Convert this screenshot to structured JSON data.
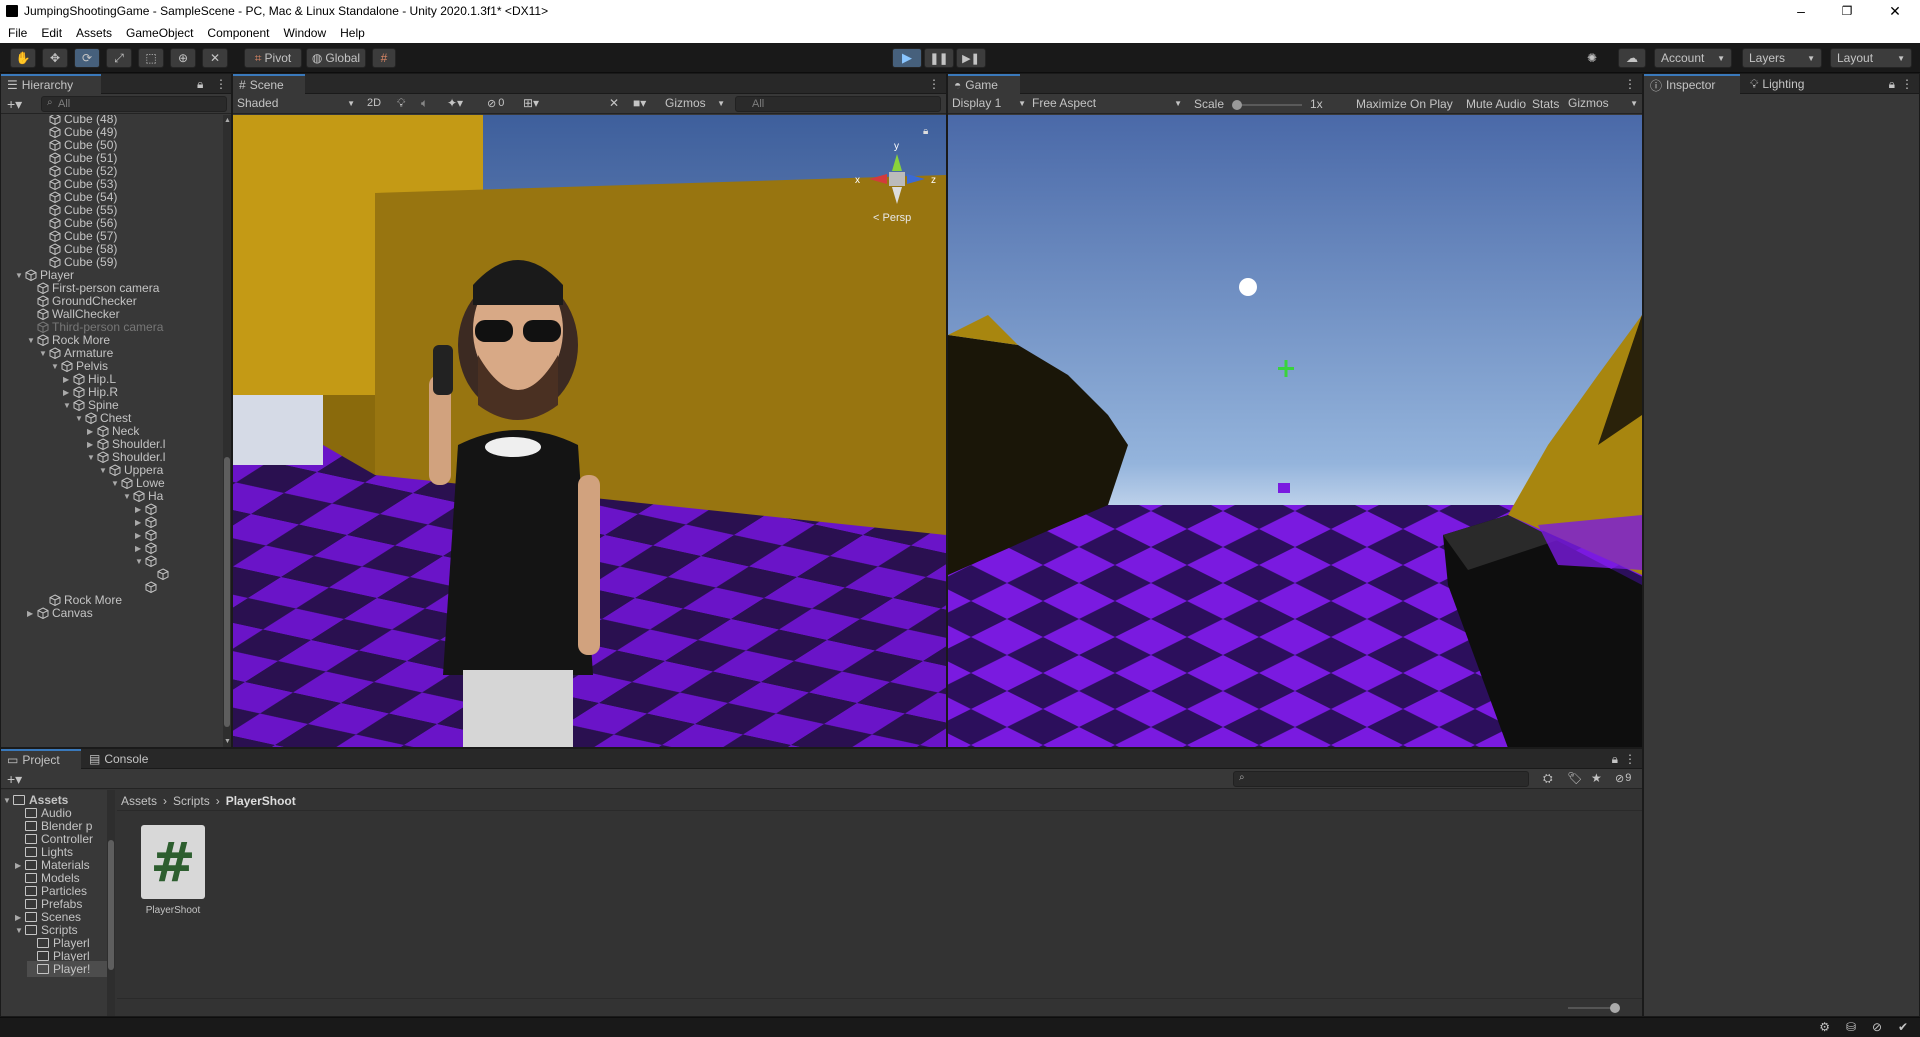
{
  "window": {
    "title": "JumpingShootingGame - SampleScene - PC, Mac & Linux Standalone - Unity 2020.1.3f1* <DX11>",
    "controls": [
      "–",
      "❐",
      "✕"
    ]
  },
  "menu": [
    "File",
    "Edit",
    "Assets",
    "GameObject",
    "Component",
    "Window",
    "Help"
  ],
  "toolbar": {
    "pivot_label": "Pivot",
    "global_label": "Global",
    "account_label": "Account",
    "layers_label": "Layers",
    "layout_label": "Layout",
    "play_active": true
  },
  "hierarchy": {
    "tab_label": "Hierarchy",
    "search_placeholder": "All",
    "items": [
      {
        "label": "Cube (48)",
        "depth": 3,
        "arrow": ""
      },
      {
        "label": "Cube (49)",
        "depth": 3,
        "arrow": ""
      },
      {
        "label": "Cube (50)",
        "depth": 3,
        "arrow": ""
      },
      {
        "label": "Cube (51)",
        "depth": 3,
        "arrow": ""
      },
      {
        "label": "Cube (52)",
        "depth": 3,
        "arrow": ""
      },
      {
        "label": "Cube (53)",
        "depth": 3,
        "arrow": ""
      },
      {
        "label": "Cube (54)",
        "depth": 3,
        "arrow": ""
      },
      {
        "label": "Cube (55)",
        "depth": 3,
        "arrow": ""
      },
      {
        "label": "Cube (56)",
        "depth": 3,
        "arrow": ""
      },
      {
        "label": "Cube (57)",
        "depth": 3,
        "arrow": ""
      },
      {
        "label": "Cube (58)",
        "depth": 3,
        "arrow": ""
      },
      {
        "label": "Cube (59)",
        "depth": 3,
        "arrow": ""
      },
      {
        "label": "Player",
        "depth": 1,
        "arrow": "▼"
      },
      {
        "label": "First-person camera",
        "depth": 2,
        "arrow": ""
      },
      {
        "label": "GroundChecker",
        "depth": 2,
        "arrow": ""
      },
      {
        "label": "WallChecker",
        "depth": 2,
        "arrow": ""
      },
      {
        "label": "Third-person camera",
        "depth": 2,
        "arrow": "",
        "dim": true
      },
      {
        "label": "Rock More",
        "depth": 2,
        "arrow": "▼"
      },
      {
        "label": "Armature",
        "depth": 3,
        "arrow": "▼"
      },
      {
        "label": "Pelvis",
        "depth": 4,
        "arrow": "▼"
      },
      {
        "label": "Hip.L",
        "depth": 5,
        "arrow": "▶"
      },
      {
        "label": "Hip.R",
        "depth": 5,
        "arrow": "▶"
      },
      {
        "label": "Spine",
        "depth": 5,
        "arrow": "▼"
      },
      {
        "label": "Chest",
        "depth": 6,
        "arrow": "▼"
      },
      {
        "label": "Neck",
        "depth": 7,
        "arrow": "▶"
      },
      {
        "label": "Shoulder.l",
        "depth": 7,
        "arrow": "▶"
      },
      {
        "label": "Shoulder.l",
        "depth": 7,
        "arrow": "▼"
      },
      {
        "label": "Uppera",
        "depth": 8,
        "arrow": "▼"
      },
      {
        "label": "Lowe",
        "depth": 9,
        "arrow": "▼"
      },
      {
        "label": "Ha",
        "depth": 10,
        "arrow": "▼"
      },
      {
        "label": "",
        "depth": 11,
        "arrow": "▶"
      },
      {
        "label": "",
        "depth": 11,
        "arrow": "▶"
      },
      {
        "label": "",
        "depth": 11,
        "arrow": "▶"
      },
      {
        "label": "",
        "depth": 11,
        "arrow": "▶"
      },
      {
        "label": "",
        "depth": 11,
        "arrow": "▼"
      },
      {
        "label": "",
        "depth": 12,
        "arrow": ""
      },
      {
        "label": "",
        "depth": 11,
        "arrow": ""
      },
      {
        "label": "Rock More",
        "depth": 3,
        "arrow": ""
      },
      {
        "label": "Canvas",
        "depth": 2,
        "arrow": "▶"
      }
    ]
  },
  "scene": {
    "tab_label": "Scene",
    "shading_label": "Shaded",
    "mode_2d_label": "2D",
    "hidden_count": "0",
    "gizmos_label": "Gizmos",
    "search_placeholder": "All",
    "persp_label": "Persp",
    "axis_labels": [
      "y",
      "x",
      "z"
    ]
  },
  "game": {
    "tab_label": "Game",
    "display_label": "Display 1",
    "aspect_label": "Free Aspect",
    "scale_label": "Scale",
    "scale_value": "1x",
    "maximize_label": "Maximize On Play",
    "mute_label": "Mute Audio",
    "stats_label": "Stats",
    "gizmos_label": "Gizmos"
  },
  "inspector": {
    "tab_label": "Inspector",
    "lighting_label": "Lighting"
  },
  "project": {
    "tab_label": "Project",
    "console_label": "Console",
    "hidden_count": "9",
    "breadcrumb": [
      "Assets",
      "Scripts",
      "PlayerShoot"
    ],
    "tree": [
      {
        "label": "Assets",
        "depth": 0,
        "arrow": "▼",
        "bold": true
      },
      {
        "label": "Audio",
        "depth": 1,
        "arrow": ""
      },
      {
        "label": "Blender p",
        "depth": 1,
        "arrow": ""
      },
      {
        "label": "Controller",
        "depth": 1,
        "arrow": ""
      },
      {
        "label": "Lights",
        "depth": 1,
        "arrow": ""
      },
      {
        "label": "Materials",
        "depth": 1,
        "arrow": "▶"
      },
      {
        "label": "Models",
        "depth": 1,
        "arrow": ""
      },
      {
        "label": "Particles",
        "depth": 1,
        "arrow": ""
      },
      {
        "label": "Prefabs",
        "depth": 1,
        "arrow": ""
      },
      {
        "label": "Scenes",
        "depth": 1,
        "arrow": "▶"
      },
      {
        "label": "Scripts",
        "depth": 1,
        "arrow": "▼"
      },
      {
        "label": "Playerl",
        "depth": 2,
        "arrow": ""
      },
      {
        "label": "Playerl",
        "depth": 2,
        "arrow": ""
      },
      {
        "label": "Player!",
        "depth": 2,
        "arrow": "",
        "selected": true
      }
    ],
    "asset": {
      "name": "PlayerShoot",
      "glyph": "#"
    }
  },
  "colors": {
    "accent": "#3a79bb",
    "play_active": "#46607c",
    "floor_purple": "#6a14c8",
    "floor_dark": "#2a1050",
    "wall_yellow": "#9a7a10",
    "crosshair": "#39d43b"
  }
}
